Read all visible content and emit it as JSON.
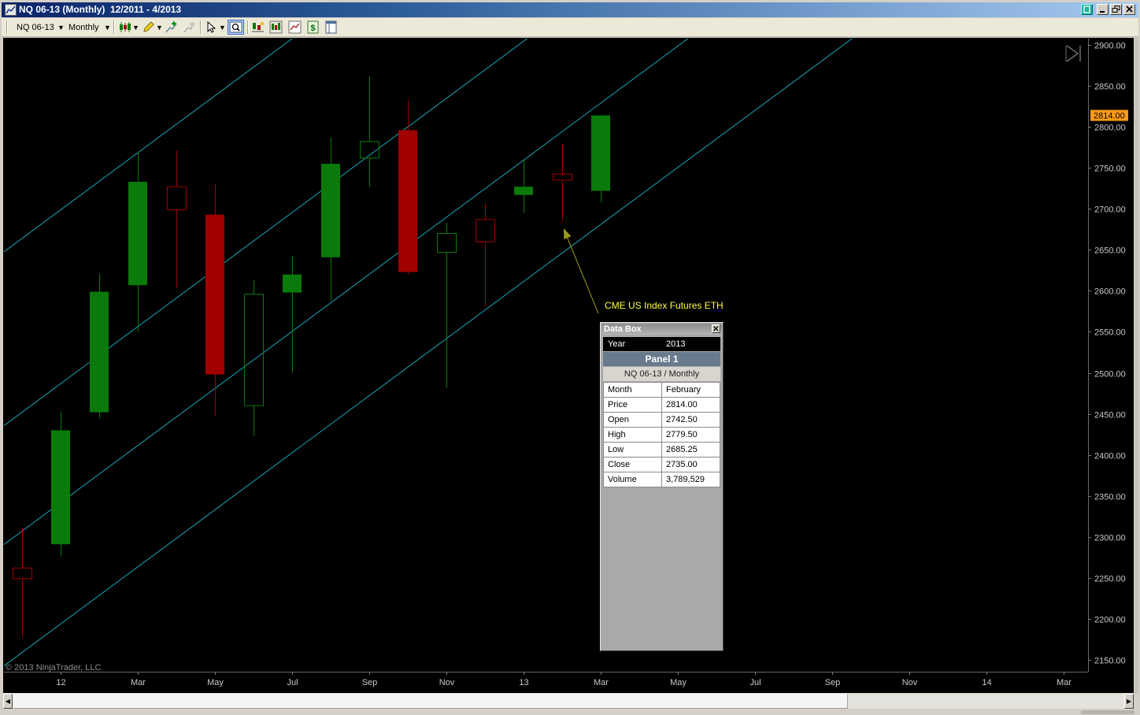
{
  "window": {
    "title": "NQ 06-13 (Monthly)  12/2011 - 4/2013"
  },
  "toolbar": {
    "instrument": "NQ 06-13",
    "period": "Monthly",
    "icons": [
      "candlestick-style-icon",
      "pencil-drawing-icon",
      "add-indicator-icon",
      "strategy-icon",
      "pointer-icon",
      "zoom-box-icon",
      "chart-properties-icon",
      "bar-type-icon",
      "chart-trader-icon",
      "dollar-icon",
      "window-layout-icon"
    ]
  },
  "chart_data": {
    "type": "candlestick",
    "ylim": [
      2150,
      2900
    ],
    "y_ticks": [
      "2900.00",
      "2850.00",
      "2800.00",
      "2750.00",
      "2700.00",
      "2650.00",
      "2600.00",
      "2550.00",
      "2500.00",
      "2450.00",
      "2400.00",
      "2350.00",
      "2300.00",
      "2250.00",
      "2200.00",
      "2150.00"
    ],
    "x_ticks": [
      {
        "label": "12",
        "index": 1
      },
      {
        "label": "Mar",
        "index": 3
      },
      {
        "label": "May",
        "index": 5
      },
      {
        "label": "Jul",
        "index": 7
      },
      {
        "label": "Sep",
        "index": 9
      },
      {
        "label": "Nov",
        "index": 11
      },
      {
        "label": "13",
        "index": 13
      },
      {
        "label": "Mar",
        "index": 15
      },
      {
        "label": "May",
        "index": 17
      },
      {
        "label": "Jul",
        "index": 19
      },
      {
        "label": "Sep",
        "index": 21
      },
      {
        "label": "Nov",
        "index": 23
      },
      {
        "label": "14",
        "index": 25
      },
      {
        "label": "Mar",
        "index": 27
      }
    ],
    "bars": [
      {
        "o": 2262,
        "h": 2311,
        "l": 2178,
        "c": 2249,
        "hollow": true
      },
      {
        "o": 2291,
        "h": 2453,
        "l": 2276,
        "c": 2430,
        "hollow": false
      },
      {
        "o": 2452,
        "h": 2621,
        "l": 2445,
        "c": 2599,
        "hollow": false
      },
      {
        "o": 2607,
        "h": 2769,
        "l": 2550,
        "c": 2733,
        "hollow": false
      },
      {
        "o": 2727,
        "h": 2771,
        "l": 2604,
        "c": 2699,
        "hollow": true
      },
      {
        "o": 2693,
        "h": 2731,
        "l": 2448,
        "c": 2498,
        "hollow": false
      },
      {
        "o": 2460,
        "h": 2613,
        "l": 2423,
        "c": 2596,
        "hollow": true
      },
      {
        "o": 2598,
        "h": 2643,
        "l": 2500,
        "c": 2620,
        "hollow": false
      },
      {
        "o": 2641,
        "h": 2787,
        "l": 2588,
        "c": 2755,
        "hollow": false
      },
      {
        "o": 2762,
        "h": 2862,
        "l": 2727,
        "c": 2782,
        "hollow": true
      },
      {
        "o": 2796,
        "h": 2832,
        "l": 2620,
        "c": 2623,
        "hollow": false
      },
      {
        "o": 2647,
        "h": 2683,
        "l": 2482,
        "c": 2670,
        "hollow": true
      },
      {
        "o": 2687,
        "h": 2707,
        "l": 2581,
        "c": 2660,
        "hollow": true
      },
      {
        "o": 2717,
        "h": 2759,
        "l": 2695,
        "c": 2727,
        "hollow": false
      },
      {
        "o": 2742.5,
        "h": 2779.5,
        "l": 2685.25,
        "c": 2735,
        "hollow": true
      },
      {
        "o": 2722,
        "h": 2814,
        "l": 2708,
        "c": 2814,
        "hollow": false
      }
    ],
    "channel": {
      "slope_per_bar": 34.8,
      "start_prices": [
        2664,
        2452,
        2307,
        2159
      ]
    },
    "last_price": "2814.00",
    "annotation": "CME US Index Futures ETH",
    "copyright": "© 2013 NinjaTrader, LLC"
  },
  "data_box": {
    "title": "Data Box",
    "year_label": "Year",
    "year_value": "2013",
    "panel": "Panel 1",
    "series": "NQ 06-13 / Monthly",
    "rows": [
      {
        "label": "Month",
        "value": "February"
      },
      {
        "label": "Price",
        "value": "2814.00"
      },
      {
        "label": "Open",
        "value": "2742.50"
      },
      {
        "label": "High",
        "value": "2779.50"
      },
      {
        "label": "Low",
        "value": "2685.25"
      },
      {
        "label": "Close",
        "value": "2735.00"
      },
      {
        "label": "Volume",
        "value": "3,789,529"
      }
    ]
  },
  "colors": {
    "background": "#000000",
    "up": "#0a7a0a",
    "down": "#a00000",
    "channel": "#1aa7b7",
    "annotation": "#ffff40",
    "arrow": "#9a9a1a",
    "price_marker": "#ff9a1a",
    "axis_text": "#c8c8c8"
  }
}
